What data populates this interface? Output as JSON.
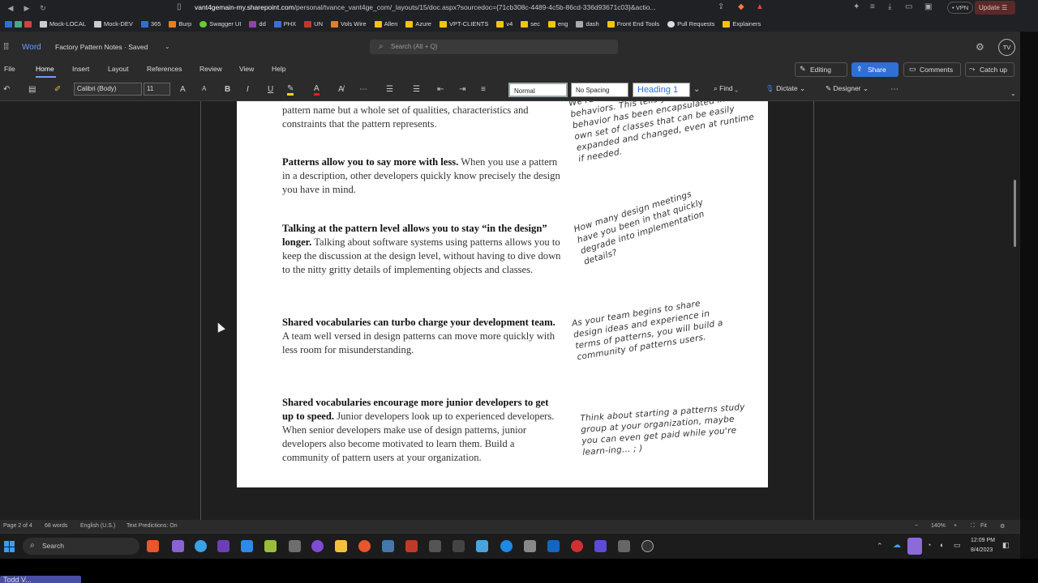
{
  "browser": {
    "url_host": "vant4gemain-my.sharepoint.com",
    "url_path": "/personal/tvance_vant4ge_com/_layouts/15/doc.aspx?sourcedoc={71cb308c-4489-4c5b-86cd-336d93671c03}&actio...",
    "vpn_label": "• VPN",
    "update_label": "Update ☰",
    "bookmarks": [
      "Mock-LOCAL",
      "Mock-DEV",
      "365",
      "Burp",
      "Swagger UI",
      "dd",
      "PHX",
      "UN",
      "Vols Wire",
      "Allen",
      "Azure",
      "VPT-CLIENTS",
      "v4",
      "sec",
      "eng",
      "dash",
      "Front End Tools",
      "Pull Requests",
      "Explainers"
    ]
  },
  "app": {
    "name": "Word",
    "doc_title": "Factory Pattern Notes · Saved",
    "search_placeholder": "Search (Alt + Q)",
    "avatar_initials": "TV"
  },
  "menu": {
    "tabs": [
      "File",
      "Home",
      "Insert",
      "Layout",
      "References",
      "Review",
      "View",
      "Help"
    ],
    "editing": "Editing",
    "share": "Share",
    "comments": "Comments",
    "catch_up": "Catch up"
  },
  "ribbon": {
    "font": "Calibri (Body)",
    "size": "11",
    "styles": [
      "Normal",
      "No Spacing",
      "Heading 1"
    ],
    "find": "Find",
    "dictate": "Dictate",
    "designer": "Designer"
  },
  "document": {
    "paragraphs": [
      {
        "bold": "",
        "text": "pattern name but a whole set of qualities, characteristics and constraints that the pattern represents."
      },
      {
        "bold": "Patterns allow you to say more with less.",
        "text": " When you use a pattern in a description, other developers quickly know precisely the design you have in mind."
      },
      {
        "bold": "Talking at the pattern level allows you to stay “in the design” longer.",
        "text": " Talking about software systems using patterns allows you to keep the discussion at the design level, without having to dive down to the nitty gritty details of implementing objects and classes."
      },
      {
        "bold": "Shared vocabularies can turbo charge your development team.",
        "text": " A team well versed in design patterns can move more quickly with less room for misunderstanding."
      },
      {
        "bold": "Shared vocabularies encourage more  junior developers to get up to speed.",
        "text": " Junior developers look up to experienced developers. When senior developers make use of design patterns, junior developers also become motivated to learn them. Build a community of pattern users at your organization."
      }
    ],
    "notes": [
      "We're using... ment the various behaviors. This tells you the duck behavior has been encapsulated into its own set of classes that can be easily expanded and changed, even at runtime if needed.",
      "How many design meetings have you been in that quickly degrade into implementation details?",
      "As your team begins to share design ideas and experience in terms of patterns, you will build a community of patterns users.",
      "Think about starting a patterns study group at your organization, maybe you can even get paid while you're learn-ing... ; )"
    ]
  },
  "status": {
    "page": "Page 2 of 4",
    "words": "68 words",
    "language": "English (U.S.)",
    "predictions": "Text Predictions: On",
    "zoom": "140%",
    "fit": "Fit"
  },
  "taskbar": {
    "search": "Search",
    "time": "12:09 PM",
    "date": "8/4/2023"
  },
  "bottom_tab": "Todd V..."
}
